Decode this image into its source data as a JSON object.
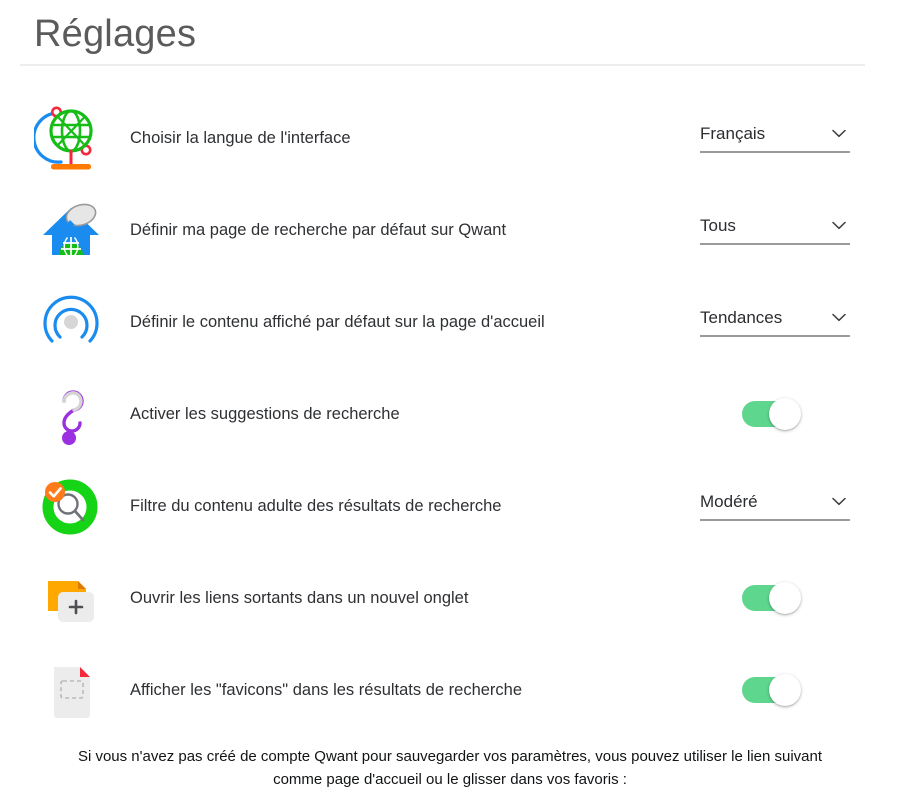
{
  "header": {
    "title": "Réglages"
  },
  "settings": {
    "rows": [
      {
        "icon": "globe-stand-icon",
        "label": "Choisir la langue de l'interface",
        "control": "select",
        "value": "Français"
      },
      {
        "icon": "home-search-icon",
        "label": "Définir ma page de recherche par défaut sur Qwant",
        "control": "select",
        "value": "Tous"
      },
      {
        "icon": "radar-trends-icon",
        "label": "Définir le contenu affiché par défaut sur la page d'accueil",
        "control": "select",
        "value": "Tendances"
      },
      {
        "icon": "question-mark-icon",
        "label": "Activer les suggestions de recherche",
        "control": "toggle",
        "value": "on"
      },
      {
        "icon": "safe-search-icon",
        "label": "Filtre du contenu adulte des résultats de recherche",
        "control": "select",
        "value": "Modéré"
      },
      {
        "icon": "new-tab-icon",
        "label": "Ouvrir les liens sortants dans un nouvel onglet",
        "control": "toggle",
        "value": "on"
      },
      {
        "icon": "favicon-page-icon",
        "label": "Afficher les \"favicons\" dans les résultats de recherche",
        "control": "toggle",
        "value": "on"
      }
    ]
  },
  "footer": {
    "line1": "Si vous n'avez pas créé de compte Qwant pour sauvegarder vos paramètres, vous pouvez utiliser le lien suivant",
    "line2": "comme page d'accueil ou le glisser dans vos favoris :"
  },
  "colors": {
    "toggle_on": "#5ed68e",
    "select_underline": "#9b9b9b",
    "title": "#5b5b5b",
    "text": "#2e3033",
    "divider": "#ededed",
    "icon_green": "#16bd16",
    "icon_blue": "#1a8cf0",
    "icon_orange": "#ff7a00",
    "icon_purple": "#9b30e0",
    "icon_red": "#f5293c",
    "icon_gray": "#d0d0d0"
  }
}
